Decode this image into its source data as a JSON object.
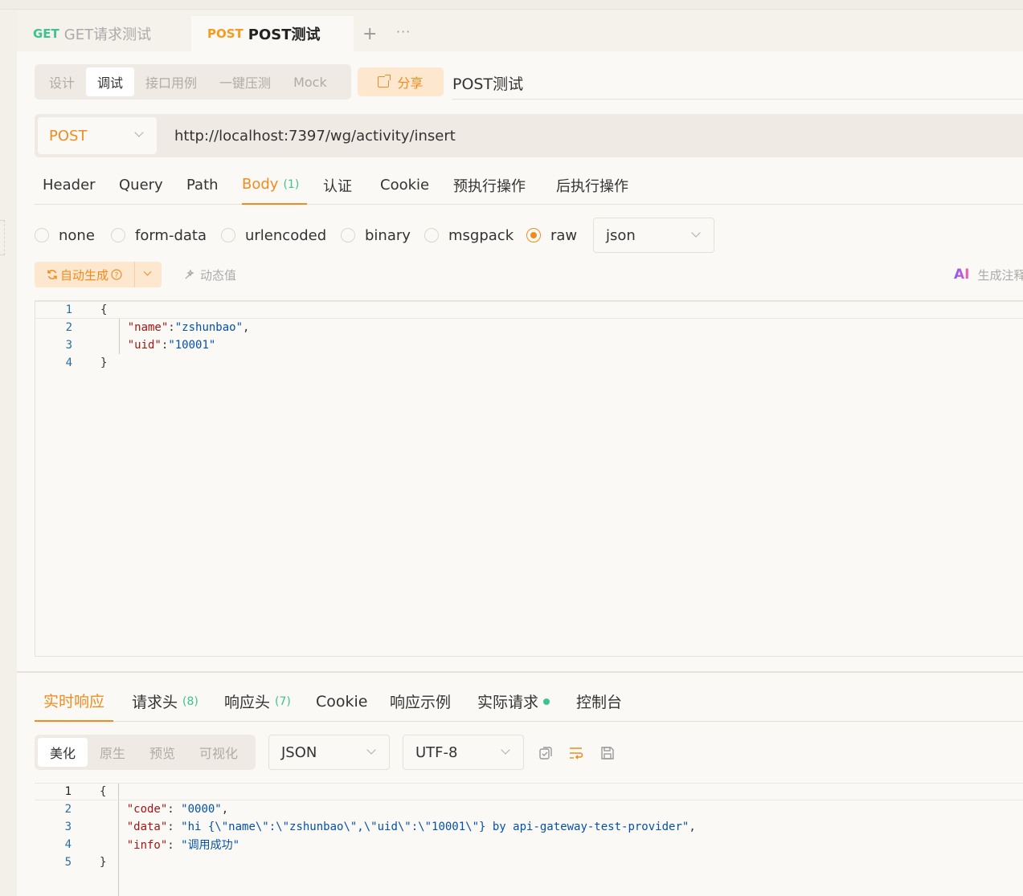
{
  "tabs": [
    {
      "method": "GET",
      "name": "GET请求测试"
    },
    {
      "method": "POST",
      "name": "POST测试"
    }
  ],
  "tab_actions": {
    "add": "+",
    "more": "···"
  },
  "modes": [
    "设计",
    "调试",
    "接口用例",
    "一键压测",
    "Mock"
  ],
  "share_label": "分享",
  "api_name": "POST测试",
  "request": {
    "method": "POST",
    "url": "http://localhost:7397/wg/activity/insert"
  },
  "req_tabs": [
    {
      "label": "Header"
    },
    {
      "label": "Query"
    },
    {
      "label": "Path"
    },
    {
      "label": "Body",
      "count": "(1)"
    },
    {
      "label": "认证"
    },
    {
      "label": "Cookie"
    },
    {
      "label": "预执行操作"
    },
    {
      "label": "后执行操作"
    }
  ],
  "body_types": [
    "none",
    "form-data",
    "urlencoded",
    "binary",
    "msgpack",
    "raw"
  ],
  "body_format": "json",
  "toolbar": {
    "autogen": "自动生成",
    "dynamic_value": "动态值",
    "ai_icon": "AI",
    "ai_generate": "生成注释"
  },
  "request_body_lines": [
    {
      "n": "1",
      "parts": [
        [
          "p",
          "{"
        ]
      ]
    },
    {
      "n": "2",
      "parts": [
        [
          "p",
          "    "
        ],
        [
          "k",
          "\"name\""
        ],
        [
          "p",
          ":"
        ],
        [
          "s",
          "\"zshunbao\""
        ],
        [
          "p",
          ","
        ]
      ]
    },
    {
      "n": "3",
      "parts": [
        [
          "p",
          "    "
        ],
        [
          "k",
          "\"uid\""
        ],
        [
          "p",
          ":"
        ],
        [
          "s",
          "\"10001\""
        ]
      ]
    },
    {
      "n": "4",
      "parts": [
        [
          "p",
          "}"
        ]
      ]
    }
  ],
  "resp_tabs": [
    {
      "label": "实时响应"
    },
    {
      "label": "请求头",
      "count": "(8)"
    },
    {
      "label": "响应头",
      "count": "(7)"
    },
    {
      "label": "Cookie"
    },
    {
      "label": "响应示例"
    },
    {
      "label": "实际请求"
    },
    {
      "label": "控制台"
    }
  ],
  "view_modes": [
    "美化",
    "原生",
    "预览",
    "可视化"
  ],
  "resp_format": "JSON",
  "resp_encoding": "UTF-8",
  "response_lines": [
    {
      "n": "1",
      "parts": [
        [
          "p",
          "{"
        ]
      ]
    },
    {
      "n": "2",
      "parts": [
        [
          "p",
          "    "
        ],
        [
          "k",
          "\"code\""
        ],
        [
          "p",
          ": "
        ],
        [
          "s",
          "\"0000\""
        ],
        [
          "p",
          ","
        ]
      ]
    },
    {
      "n": "3",
      "parts": [
        [
          "p",
          "    "
        ],
        [
          "k",
          "\"data\""
        ],
        [
          "p",
          ": "
        ],
        [
          "s",
          "\"hi {\\\"name\\\":\\\"zshunbao\\\",\\\"uid\\\":\\\"10001\\\"} by api-gateway-test-provider\""
        ],
        [
          "p",
          ","
        ]
      ]
    },
    {
      "n": "4",
      "parts": [
        [
          "p",
          "    "
        ],
        [
          "k",
          "\"info\""
        ],
        [
          "p",
          ": "
        ],
        [
          "s",
          "\"调用成功\""
        ]
      ]
    },
    {
      "n": "5",
      "parts": [
        [
          "p",
          "}"
        ]
      ]
    }
  ],
  "colors": {
    "accent": "#f08c1f",
    "count_green": "#3ec28f",
    "key": "#a31515",
    "string": "#0451a5"
  }
}
